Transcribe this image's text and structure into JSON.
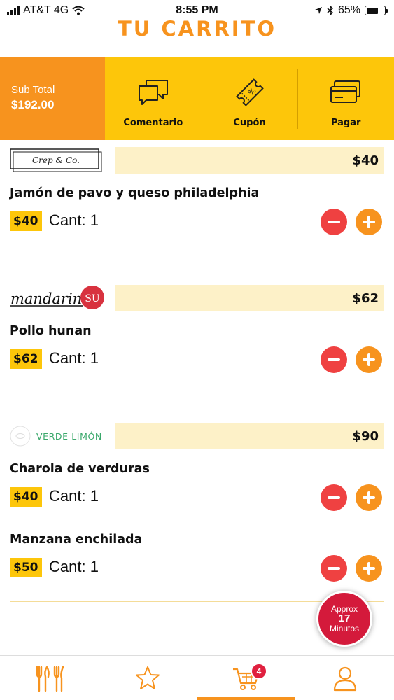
{
  "status_bar": {
    "carrier": "AT&T 4G",
    "time": "8:55 PM",
    "battery": "65%"
  },
  "title": "TU CARRITO",
  "subtotal": {
    "label": "Sub Total",
    "value": "$192.00"
  },
  "actions": [
    {
      "label": "Comentario",
      "icon": "comment-icon"
    },
    {
      "label": "Cupón",
      "icon": "coupon-icon"
    },
    {
      "label": "Pagar",
      "icon": "credit-card-icon"
    }
  ],
  "restaurants": [
    {
      "name": "Crep & Co.",
      "total": "$40",
      "items": [
        {
          "name": "Jamón de pavo y queso philadelphia",
          "price": "$40",
          "qty_label": "Cant:",
          "qty": "1"
        }
      ]
    },
    {
      "name": "mandarin",
      "logo_suffix": "SU",
      "total": "$62",
      "items": [
        {
          "name": "Pollo hunan",
          "price": "$62",
          "qty_label": "Cant:",
          "qty": "1"
        }
      ]
    },
    {
      "name": "VERDE LIMÓN",
      "total": "$90",
      "items": [
        {
          "name": "Charola de verduras",
          "price": "$40",
          "qty_label": "Cant:",
          "qty": "1"
        },
        {
          "name": "Manzana enchilada",
          "price": "$50",
          "qty_label": "Cant:",
          "qty": "1"
        }
      ]
    }
  ],
  "eta": {
    "line1": "Approx",
    "minutes": "17",
    "line3": "Minutos"
  },
  "tabs": [
    {
      "icon": "utensils-icon"
    },
    {
      "icon": "star-icon"
    },
    {
      "icon": "cart-icon",
      "active": true,
      "badge": "4"
    },
    {
      "icon": "user-icon"
    }
  ],
  "colors": {
    "orange": "#f7931e",
    "yellow": "#fdc60a",
    "red": "#ef4141",
    "band": "#fdf1c8"
  }
}
